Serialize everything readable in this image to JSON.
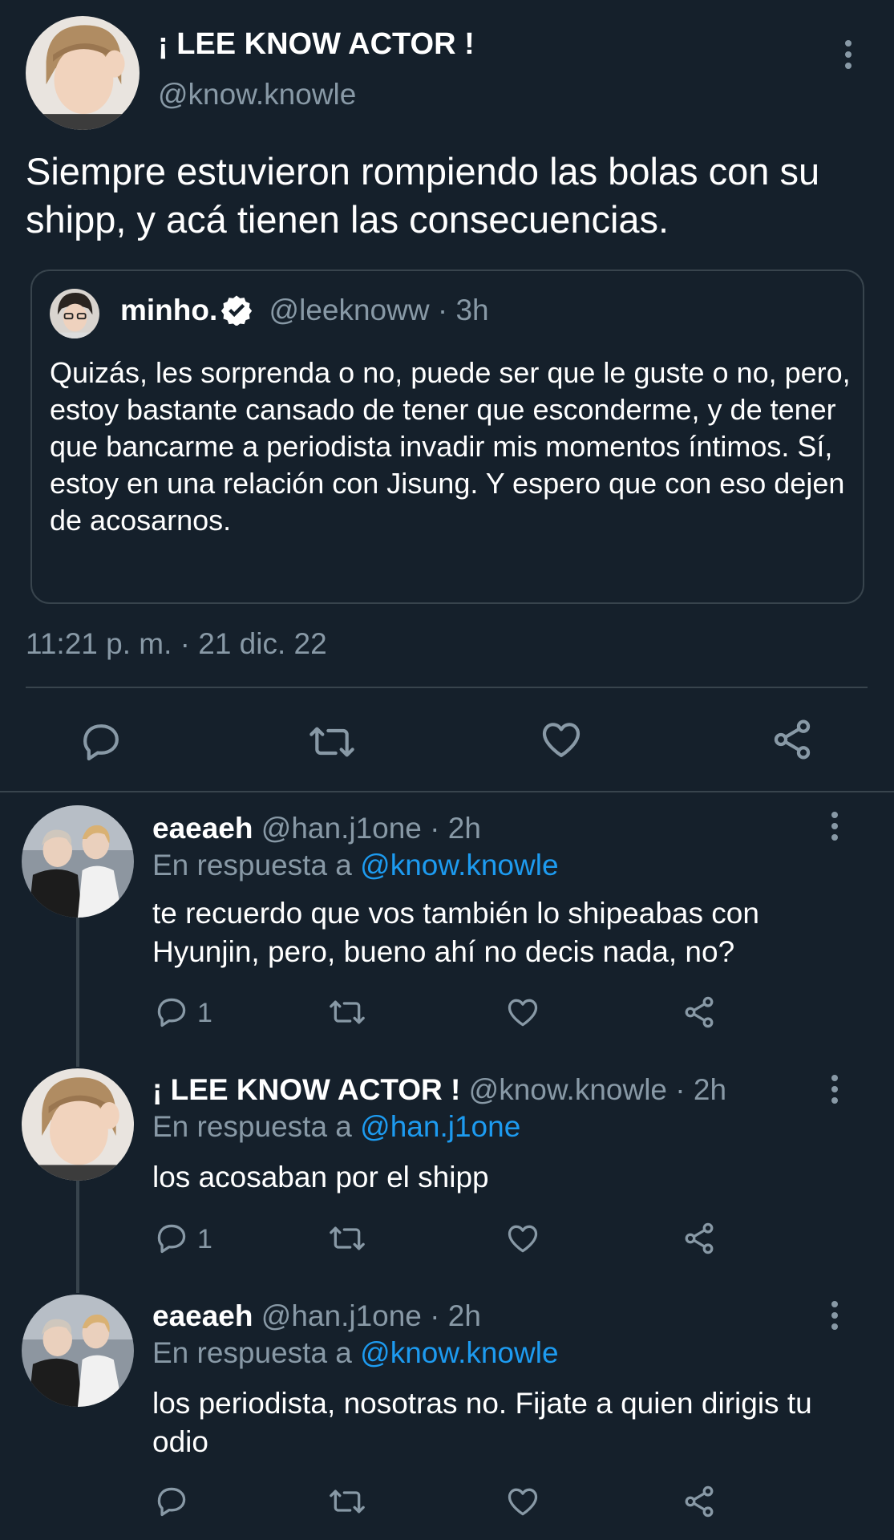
{
  "main_tweet": {
    "display_name": "¡ LEE KNOW ACTOR !",
    "handle": "@know.knowle",
    "text": "Siempre estuvieron rompiendo las bolas con su shipp, y acá tienen las consecuencias.",
    "timestamp": "11:21 p. m. · 21 dic. 22",
    "quoted": {
      "display_name": "minho.",
      "handle": "@leeknoww",
      "time": "· 3h",
      "text": "Quizás, les sorprenda o no, puede ser que le guste o no, pero, estoy bastante cansado de tener que esconderme, y de tener que bancarme a periodista invadir mis momentos íntimos. Sí, estoy en una relación con Jisung. Y espero que con eso dejen de acosarnos."
    }
  },
  "replies": [
    {
      "display_name": "eaeaeh",
      "handle": "@han.j1one",
      "time": "· 2h",
      "reply_prefix": "En respuesta a",
      "reply_to": "@know.knowle",
      "text": "te recuerdo que vos también lo shipeabas con Hyunjin, pero, bueno ahí no decis nada, no?",
      "reply_count": "1"
    },
    {
      "display_name": "¡ LEE KNOW ACTOR !",
      "handle": "@know.knowle",
      "time": "· 2h",
      "reply_prefix": "En respuesta a",
      "reply_to": "@han.j1one",
      "text": "los acosaban por el shipp",
      "reply_count": "1"
    },
    {
      "display_name": "eaeaeh",
      "handle": "@han.j1one",
      "time": "· 2h",
      "reply_prefix": "En respuesta a",
      "reply_to": "@know.knowle",
      "text": "los periodista, nosotras no. Fijate a quien dirigis tu odio",
      "reply_count": ""
    }
  ],
  "colors": {
    "background": "#15202b",
    "muted": "#8899a6",
    "link": "#1d9bf0",
    "divider": "#38444d"
  },
  "icons": [
    "more-vert-icon",
    "reply-icon",
    "retweet-icon",
    "like-icon",
    "share-icon",
    "verified-badge-icon"
  ]
}
